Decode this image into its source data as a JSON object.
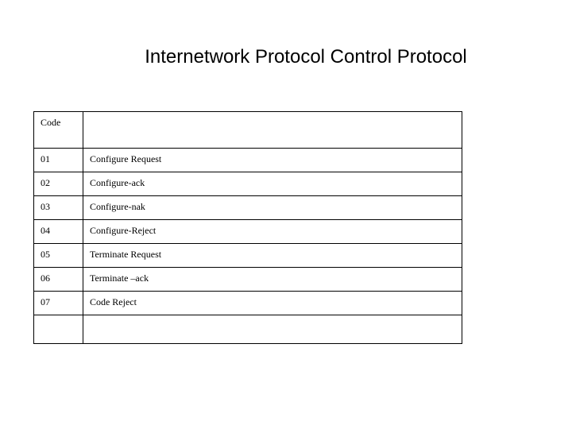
{
  "title": "Internetwork Protocol Control Protocol",
  "table": {
    "header": {
      "code": "Code",
      "desc": ""
    },
    "rows": [
      {
        "code": "01",
        "desc": "Configure Request"
      },
      {
        "code": "02",
        "desc": "Configure-ack"
      },
      {
        "code": "03",
        "desc": "Configure-nak"
      },
      {
        "code": "04",
        "desc": "Configure-Reject"
      },
      {
        "code": "05",
        "desc": "Terminate Request"
      },
      {
        "code": "06",
        "desc": "Terminate –ack"
      },
      {
        "code": "07",
        "desc": "Code Reject"
      }
    ],
    "footer": {
      "code": "",
      "desc": ""
    }
  }
}
